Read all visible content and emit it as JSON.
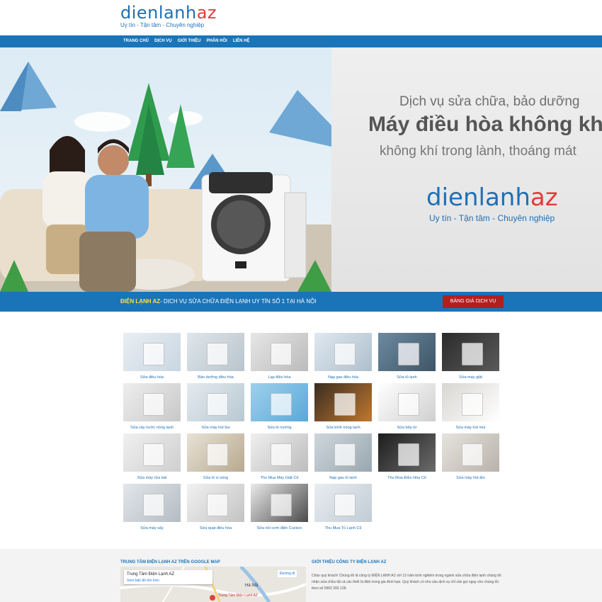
{
  "header": {
    "logo_main": "dienlanh",
    "logo_az": "az",
    "tagline": "Uy tín - Tận tâm - Chuyên nghiệp"
  },
  "nav": [
    "TRANG CHỦ",
    "DỊCH VỤ",
    "GIỚI THIỆU",
    "PHẢN HỒI",
    "LIÊN HỆ"
  ],
  "banner": {
    "line1": "Dịch vụ sửa chữa, bảo dưỡng",
    "line2": "Máy điều hòa không khí",
    "line3": "không khí trong lành, thoáng mát",
    "logo_main": "dienlanh",
    "logo_az": "az",
    "logo_tagline": "Uy tín - Tận tâm - Chuyên nghiệp"
  },
  "strip": {
    "highlight": "ĐIỆN LẠNH AZ",
    "text": "- DỊCH VỤ SỬA CHỮA ĐIỆN LẠNH UY TÍN SỐ 1 TẠI HÀ NỘI",
    "button": "BẢNG GIÁ DỊCH VỤ"
  },
  "services": [
    "Sửa điều hòa",
    "Bảo dưỡng điều hòa",
    "Lạp điều hòa",
    "Nạp gas điều hòa",
    "Sửa tủ lạnh",
    "Sửa máy giặt",
    "Sửa cây nước nóng lạnh",
    "Sửa máy hút bụi",
    "Sửa lò nướng",
    "Sửa bình nóng lạnh",
    "Sửa bếp từ",
    "Sửa máy hút mùi",
    "Sửa máy rửa bát",
    "Sửa lò vi sóng",
    "Thu Mua Máy Giặt Cũ",
    "Nạp gas tủ lạnh",
    "Thu Mua Điều Hòa Cũ",
    "Sửa máy hút ẩm",
    "Sửa máy sấy",
    "Sửa quạt điều hòa",
    "Sửa nồi cơm điện Cuckoo",
    "Thu Mua Tủ Lạnh Cũ"
  ],
  "footer": {
    "map_heading": "TRUNG TÂM ĐIỆN LẠNH AZ TRÊN GOOGLE MAP",
    "about_heading": "GIỚI THIỆU CÔNG TY ĐIỆN LẠNH AZ",
    "map_place": "Trung Tâm Điện Lạnh AZ",
    "map_link": "Xem bản đồ lớn hơn",
    "map_city": "Hà Nội",
    "map_directions": "Đường đi",
    "map_pin_label": "Trung Tâm Điện Lạnh AZ",
    "about_text": "Chào quý khách! Chúng tôi là công ty ĐIỆN LẠNH AZ với 12 năm kinh nghiệm trong ngành sửa chữa điện lạnh chúng tôi nhận sửa chữa tất cả các thiết bị điện trong gia đình bạn. Quý khách có nhu cầu dịch vụ chỉ cần gọi ngay cho chúng tôi theo số 0962 283 128."
  },
  "colors": {
    "brand_blue": "#1a74b8",
    "accent_red": "#b21f1f",
    "highlight_yellow": "#ffe23c"
  }
}
